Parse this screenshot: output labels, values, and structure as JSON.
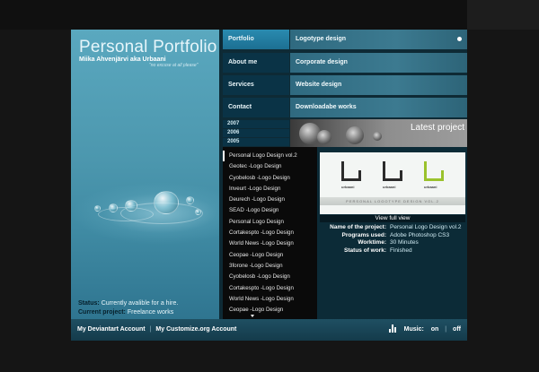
{
  "header": {
    "title": "Personal Portfolio",
    "author": "Miika Ahvenjärvi aka Urbaani",
    "tagline": "\"no excuse at all please\""
  },
  "nav": {
    "items": [
      {
        "label": "Portfolio",
        "active": true
      },
      {
        "label": "About me",
        "active": false
      },
      {
        "label": "Services",
        "active": false
      },
      {
        "label": "Contact",
        "active": false
      }
    ]
  },
  "categories": {
    "items": [
      {
        "label": "Logotype design",
        "active": true
      },
      {
        "label": "Corporate design",
        "active": false
      },
      {
        "label": "Website design",
        "active": false
      },
      {
        "label": "Downloadabe works",
        "active": false
      }
    ]
  },
  "years": [
    "2007",
    "2006",
    "2005"
  ],
  "latest_project": {
    "label": "Latest project"
  },
  "works": {
    "selected_index": 0,
    "items": [
      "Personal Logo Design vol.2",
      "Geotec -Logo Design",
      "Cyobelosb -Logo Design",
      "Inveurt -Logo Design",
      "Deurech -Logo Design",
      "SEAD -Logo Design",
      "Personal Logo Design",
      "Cortakespto -Logo Design",
      "World News -Logo Design",
      "Ceopae -Logo Design",
      "3forone -Logo Design",
      "Cyobelosb -Logo Design",
      "Cortakespto -Logo Design",
      "World News -Logo Design",
      "Ceopae -Logo Design"
    ]
  },
  "preview": {
    "logo_caption": "urbaani",
    "band_text": "PERSONAL LOGOTYPE DESIGN VOL.2",
    "logo_colors": [
      "#2b2b2b",
      "#2b2b2b",
      "#9ac22c"
    ],
    "view_full": "View full view"
  },
  "project_info": [
    {
      "key": "Name of the project:",
      "value": "Personal Logo Design vol.2"
    },
    {
      "key": "Programs used:",
      "value": "Adobe Photoshop CS3"
    },
    {
      "key": "Worktime:",
      "value": "30 Minutes"
    },
    {
      "key": "Status of work:",
      "value": "Finished"
    }
  ],
  "status": {
    "status_label": "Status:",
    "status_value": "Currently avalible for a hire.",
    "project_label": "Current project:",
    "project_value": "Freelance works"
  },
  "footer": {
    "link_deviantart": "My Deviantart Account",
    "separator": "|",
    "link_customize": "My Customize.org Account",
    "music_label": "Music:",
    "music_on": "on",
    "music_off": "off"
  },
  "colors": {
    "accent_blue": "#2a8bb0",
    "nav_dark": "#0a3346",
    "list_bg": "#0a0a0a"
  }
}
